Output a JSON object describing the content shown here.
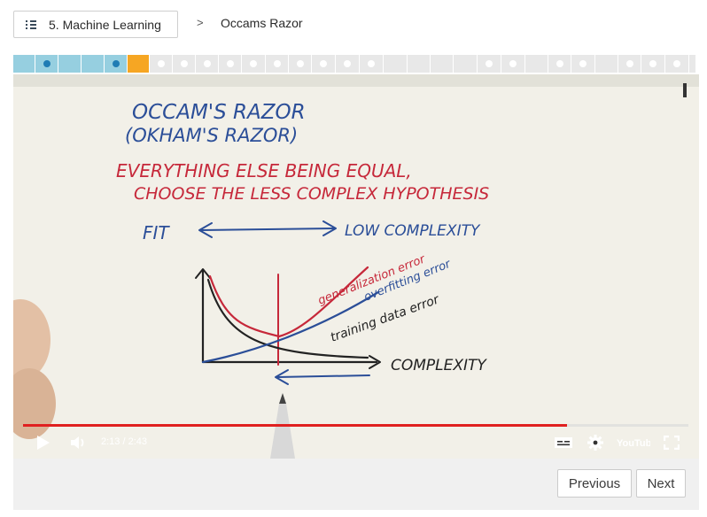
{
  "header": {
    "lesson_label": "5. Machine Learning",
    "separator": ">",
    "title": "Occams Razor"
  },
  "progress": {
    "segments": [
      {
        "state": "done",
        "dot": false
      },
      {
        "state": "done",
        "dot": true
      },
      {
        "state": "done",
        "dot": false
      },
      {
        "state": "done",
        "dot": false
      },
      {
        "state": "done",
        "dot": true
      },
      {
        "state": "current",
        "dot": false
      },
      {
        "state": "todo",
        "dot": true
      },
      {
        "state": "todo",
        "dot": true
      },
      {
        "state": "todo",
        "dot": true
      },
      {
        "state": "todo",
        "dot": true
      },
      {
        "state": "todo",
        "dot": true
      },
      {
        "state": "todo",
        "dot": true
      },
      {
        "state": "todo",
        "dot": true
      },
      {
        "state": "todo",
        "dot": true
      },
      {
        "state": "todo",
        "dot": true
      },
      {
        "state": "todo",
        "dot": true
      },
      {
        "state": "todo",
        "dot": false
      },
      {
        "state": "todo",
        "dot": false
      },
      {
        "state": "todo",
        "dot": false
      },
      {
        "state": "todo",
        "dot": false
      },
      {
        "state": "todo",
        "dot": true
      },
      {
        "state": "todo",
        "dot": true
      },
      {
        "state": "todo",
        "dot": false
      },
      {
        "state": "todo",
        "dot": true
      },
      {
        "state": "todo",
        "dot": true
      },
      {
        "state": "todo",
        "dot": false
      },
      {
        "state": "todo",
        "dot": true
      },
      {
        "state": "todo",
        "dot": true
      },
      {
        "state": "todo",
        "dot": true
      },
      {
        "state": "todo",
        "dot": false
      }
    ],
    "colors": {
      "done": "#96cfe0",
      "current": "#f6a623",
      "todo": "#e8e8e8",
      "dot_done": "#1f7cb4",
      "dot_todo": "#ffffff"
    }
  },
  "video": {
    "board_text": {
      "title1": "OCCAM'S RAZOR",
      "title2": "(OKHAM'S RAZOR)",
      "line1": "EVERYTHING ELSE BEING EQUAL,",
      "line2": "CHOOSE THE LESS COMPLEX HYPOTHESIS",
      "fit": "FIT",
      "low_complexity": "LOW COMPLEXITY",
      "gen_error": "generalization error",
      "overfit_error": "overfitting error",
      "train_error": "training data error",
      "complexity": "COMPLEXITY"
    },
    "played_fraction": 0.817,
    "time": "2:13 / 2:43",
    "youtube_label": "YouTube"
  },
  "footer": {
    "previous": "Previous",
    "next": "Next"
  }
}
